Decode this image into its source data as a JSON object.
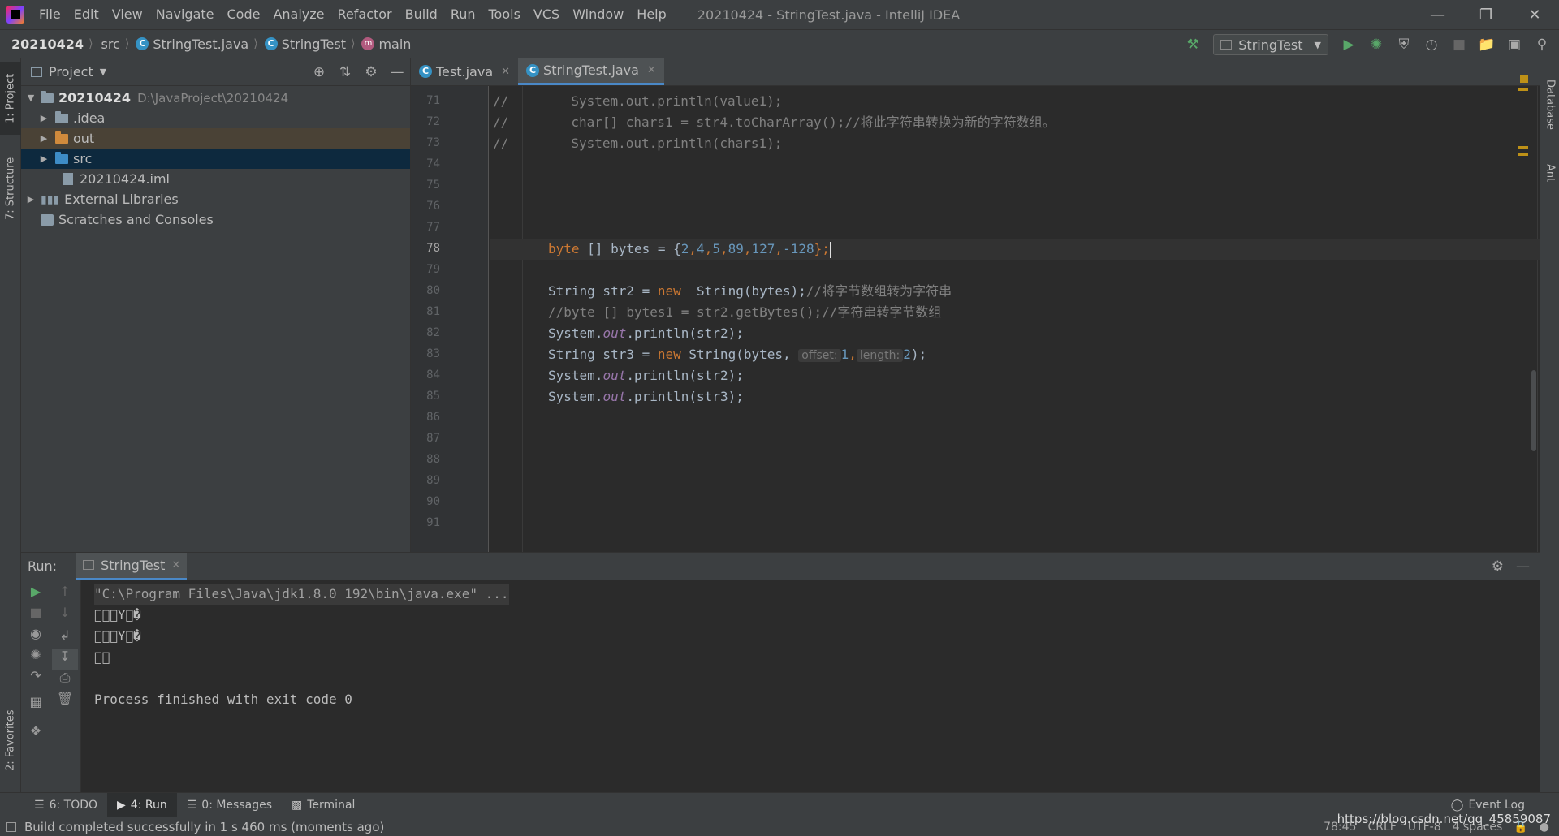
{
  "window": {
    "title": "20210424 - StringTest.java - IntelliJ IDEA",
    "menu": [
      "File",
      "Edit",
      "View",
      "Navigate",
      "Code",
      "Analyze",
      "Refactor",
      "Build",
      "Run",
      "Tools",
      "VCS",
      "Window",
      "Help"
    ]
  },
  "breadcrumb": {
    "project": "20210424",
    "dir": "src",
    "file": "StringTest.java",
    "class": "StringTest",
    "method": "main"
  },
  "run_config": {
    "name": "StringTest"
  },
  "left_stripe": {
    "project_tab": "1: Project",
    "structure_tab": "7: Structure",
    "favorites_tab": "2: Favorites"
  },
  "right_stripe": {
    "database_tab": "Database",
    "ant_tab": "Ant"
  },
  "project_panel": {
    "title": "Project",
    "root": {
      "name": "20210424",
      "path": "D:\\JavaProject\\20210424"
    },
    "items": [
      {
        "name": ".idea"
      },
      {
        "name": "out"
      },
      {
        "name": "src"
      },
      {
        "name": "20210424.iml"
      }
    ],
    "external": "External Libraries",
    "scratches": "Scratches and Consoles"
  },
  "editor": {
    "tabs": [
      {
        "label": "Test.java",
        "active": false
      },
      {
        "label": "StringTest.java",
        "active": true
      }
    ],
    "current_line": 78,
    "lines": [
      {
        "n": "71",
        "code": "//        System.out.println(value1);"
      },
      {
        "n": "72",
        "code": "//        char[] chars1 = str4.toCharArray();//将此字符串转换为新的字符数组。"
      },
      {
        "n": "73",
        "code": "//        System.out.println(chars1);"
      },
      {
        "n": "74",
        "code": ""
      },
      {
        "n": "75",
        "code": ""
      },
      {
        "n": "76",
        "code": ""
      },
      {
        "n": "77",
        "code": ""
      },
      {
        "n": "78",
        "code": "byte [] bytes = {2,4,5,89,127,-128};"
      },
      {
        "n": "79",
        "code": ""
      },
      {
        "n": "80",
        "code": "String str2 = new  String(bytes);//将字节数组转为字符串"
      },
      {
        "n": "81",
        "code": "//byte [] bytes1 = str2.getBytes();//字符串转字节数组"
      },
      {
        "n": "82",
        "code": "System.out.println(str2);"
      },
      {
        "n": "83",
        "code": "String str3 = new String(bytes, offset: 1, length: 2);"
      },
      {
        "n": "84",
        "code": "System.out.println(str2);"
      },
      {
        "n": "85",
        "code": "System.out.println(str3);"
      },
      {
        "n": "86",
        "code": ""
      },
      {
        "n": "87",
        "code": ""
      },
      {
        "n": "88",
        "code": ""
      },
      {
        "n": "89",
        "code": ""
      },
      {
        "n": "90",
        "code": ""
      },
      {
        "n": "91",
        "code": ""
      }
    ],
    "tokens": {
      "kw_byte": "byte",
      "l78_rest1": " [] bytes = {",
      "n2": "2",
      "n4": "4",
      "n5": "5",
      "n89": "89",
      "n127": "127",
      "n128": "-128",
      "comma": ",",
      "l78_end": "};",
      "l80_a": "String str2 = ",
      "kw_new": "new",
      "l80_b": "  String(bytes);",
      "l80_c": "//将字节数组转为字符串",
      "sys": "System.",
      "out": "out",
      "l82_b": ".println(str2);",
      "l83_a": "String str3 = ",
      "l83_b": " String(bytes, ",
      "hint_offset": "offset:",
      "v1": "1",
      "hint_length": "length:",
      "v2": "2",
      "l83_end": ");",
      "l85_b": ".println(str3);"
    }
  },
  "run_panel": {
    "label": "Run:",
    "tab": "StringTest",
    "console": [
      "\"C:\\Program Files\\Java\\jdk1.8.0_192\\bin\\java.exe\" ...",
      "\u0000\u0000\u0000Y\u0000�",
      "\u0000\u0000\u0000Y\u0000�",
      "\u0000\u0000",
      "",
      "Process finished with exit code 0"
    ]
  },
  "bottom_tabs": [
    {
      "label": "6: TODO"
    },
    {
      "label": "4: Run",
      "active": true
    },
    {
      "label": "0: Messages"
    },
    {
      "label": "Terminal"
    }
  ],
  "event_log": "Event Log",
  "status": {
    "message": "Build completed successfully in 1 s 460 ms (moments ago)",
    "position": "78:45",
    "line_sep": "CRLF",
    "encoding": "UTF-8",
    "indent": "4 spaces"
  },
  "watermark": "https://blog.csdn.net/qq_45859087"
}
